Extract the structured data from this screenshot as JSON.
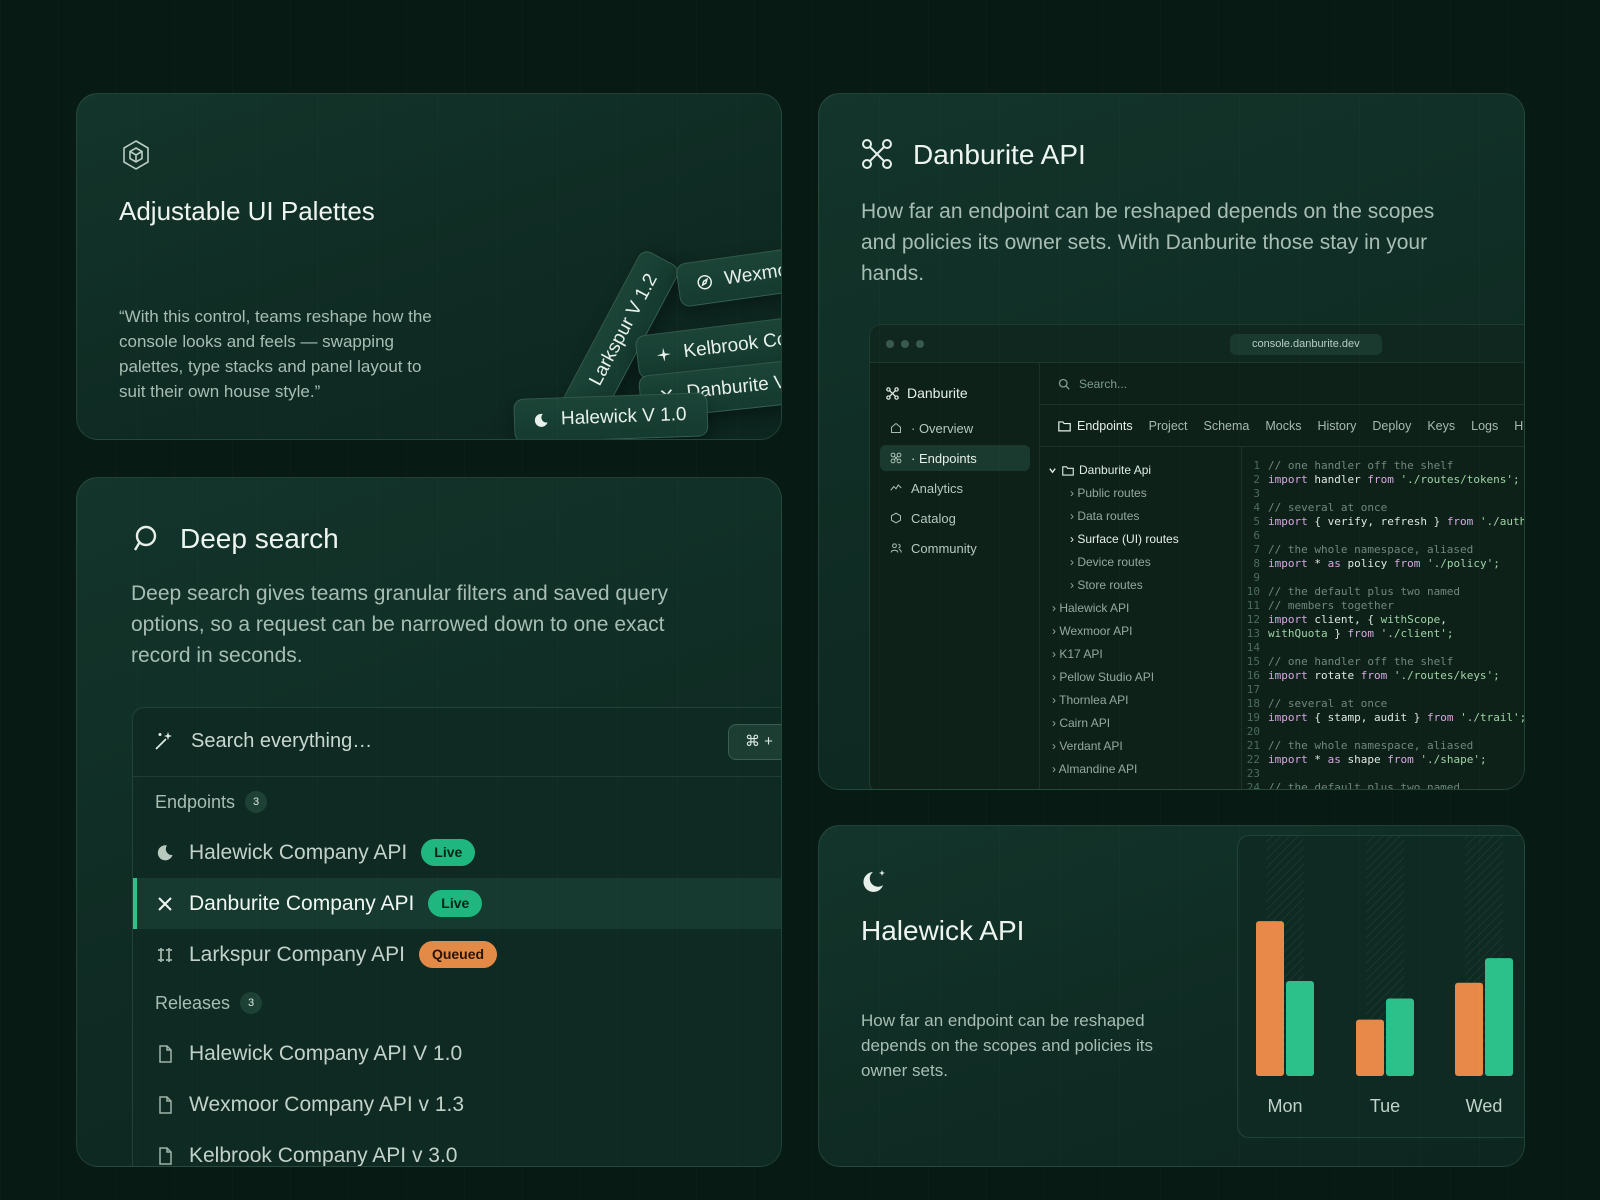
{
  "palettes": {
    "title": "Adjustable UI Palettes",
    "quote": "“With this control, teams reshape how the console looks and feels — swapping palettes, type stacks and panel layout to suit their own house style.”",
    "pills": [
      "Larkspur V 1.2",
      "Wexmoor",
      "Kelbrook Co",
      "Danburite V",
      "Halewick V 1.0"
    ]
  },
  "danburite": {
    "title": "Danburite API",
    "description": "How far an endpoint can be reshaped depends on the scopes and policies its owner sets. With Danburite those stay in your hands.",
    "console": {
      "url": "console.danburite.dev",
      "brand": "Danburite",
      "nav": [
        {
          "label": "· Overview",
          "icon": "home-icon"
        },
        {
          "label": "· Endpoints",
          "icon": "command-icon",
          "active": true
        },
        {
          "label": "Analytics",
          "icon": "activity-icon"
        },
        {
          "label": "Catalog",
          "icon": "hexagon-icon"
        },
        {
          "label": "Community",
          "icon": "users-icon"
        }
      ],
      "search_placeholder": "Search...",
      "tabs": [
        "Endpoints",
        "Project",
        "Schema",
        "Mocks",
        "History",
        "Deploy",
        "Keys",
        "Logs",
        "H"
      ],
      "tree_root": "Danburite Api",
      "tree_sub": [
        "Public routes",
        "Data routes",
        "Surface (UI) routes",
        "Device routes",
        "Store routes"
      ],
      "tree_top": [
        "Halewick API",
        "Wexmoor API",
        "K17 API",
        "Pellow Studio API",
        "Thornlea API",
        "Cairn API",
        "Verdant API",
        "Almandine API"
      ],
      "code": [
        [
          {
            "c": "cm",
            "t": "// one handler off the shelf"
          }
        ],
        [
          {
            "c": "kw",
            "t": "import "
          },
          {
            "c": "tx",
            "t": "handler "
          },
          {
            "c": "kw",
            "t": "from "
          },
          {
            "c": "st",
            "t": "'./routes/tokens';"
          }
        ],
        [],
        [
          {
            "c": "cm",
            "t": "// several at once"
          }
        ],
        [
          {
            "c": "kw",
            "t": "import "
          },
          {
            "c": "tx",
            "t": "{ verify, refresh } "
          },
          {
            "c": "kw",
            "t": "from "
          },
          {
            "c": "st",
            "t": "'./auth';"
          }
        ],
        [],
        [
          {
            "c": "cm",
            "t": "// the whole namespace, aliased"
          }
        ],
        [
          {
            "c": "kw",
            "t": "import "
          },
          {
            "c": "tx",
            "t": "* "
          },
          {
            "c": "kw",
            "t": "as "
          },
          {
            "c": "tx",
            "t": "policy "
          },
          {
            "c": "kw",
            "t": "from "
          },
          {
            "c": "st",
            "t": "'./policy';"
          }
        ],
        [],
        [
          {
            "c": "cm",
            "t": "// the default plus two named"
          }
        ],
        [
          {
            "c": "cm",
            "t": "// members together"
          }
        ],
        [
          {
            "c": "kw",
            "t": "import "
          },
          {
            "c": "tx",
            "t": "client, { "
          },
          {
            "c": "st",
            "t": "withScope"
          },
          {
            "c": "tx",
            "t": ","
          }
        ],
        [
          {
            "c": "st",
            "t": "withQuota "
          },
          {
            "c": "tx",
            "t": "} "
          },
          {
            "c": "kw",
            "t": "from "
          },
          {
            "c": "st",
            "t": "'./client';"
          }
        ],
        [],
        [
          {
            "c": "cm",
            "t": "// one handler off the shelf"
          }
        ],
        [
          {
            "c": "kw",
            "t": "import "
          },
          {
            "c": "tx",
            "t": "rotate "
          },
          {
            "c": "kw",
            "t": "from "
          },
          {
            "c": "st",
            "t": "'./routes/keys';"
          }
        ],
        [],
        [
          {
            "c": "cm",
            "t": "// several at once"
          }
        ],
        [
          {
            "c": "kw",
            "t": "import "
          },
          {
            "c": "tx",
            "t": "{ stamp, audit } "
          },
          {
            "c": "kw",
            "t": "from "
          },
          {
            "c": "st",
            "t": "'./trail';"
          }
        ],
        [],
        [
          {
            "c": "cm",
            "t": "// the whole namespace, aliased"
          }
        ],
        [
          {
            "c": "kw",
            "t": "import "
          },
          {
            "c": "tx",
            "t": "* "
          },
          {
            "c": "kw",
            "t": "as "
          },
          {
            "c": "tx",
            "t": "shape "
          },
          {
            "c": "kw",
            "t": "from "
          },
          {
            "c": "st",
            "t": "'./shape';"
          }
        ],
        [],
        [
          {
            "c": "cm",
            "t": "// the default plus two named"
          }
        ]
      ]
    }
  },
  "deepsearch": {
    "title": "Deep search",
    "description": "Deep search gives teams granular filters and saved query options, so a request can be narrowed down to one exact record in seconds.",
    "placeholder": "Search everything…",
    "shortcut": "⌘ +",
    "groups": [
      {
        "label": "Endpoints",
        "count": "3"
      },
      {
        "label": "Releases",
        "count": "3"
      }
    ],
    "endpoints": [
      {
        "label": "Halewick Company API",
        "badge": "Live",
        "icon": "moon-icon"
      },
      {
        "label": "Danburite Company API",
        "badge": "Live",
        "icon": "close-x-icon",
        "selected": true
      },
      {
        "label": "Larkspur Company API",
        "badge": "Queued",
        "icon": "pillars-icon"
      }
    ],
    "releases": [
      "Halewick Company API V 1.0",
      "Wexmoor Company API v 1.3",
      "Kelbrook Company API v 3.0"
    ]
  },
  "halewick": {
    "title": "Halewick API",
    "description": "How far an endpoint can be reshaped depends on the scopes and policies its owner sets."
  },
  "chart_data": {
    "type": "bar",
    "categories": [
      "Mon",
      "Tue",
      "Wed"
    ],
    "series": [
      {
        "values": [
          88,
          32,
          53
        ],
        "color": "#e8894a"
      },
      {
        "values": [
          54,
          44,
          67
        ],
        "color": "#2cc08a"
      }
    ],
    "ylim": [
      0,
      100
    ],
    "grid": false
  },
  "colors": {
    "accent_green": "#1fb77f",
    "accent_orange": "#e38b46",
    "background": "#081a14"
  }
}
